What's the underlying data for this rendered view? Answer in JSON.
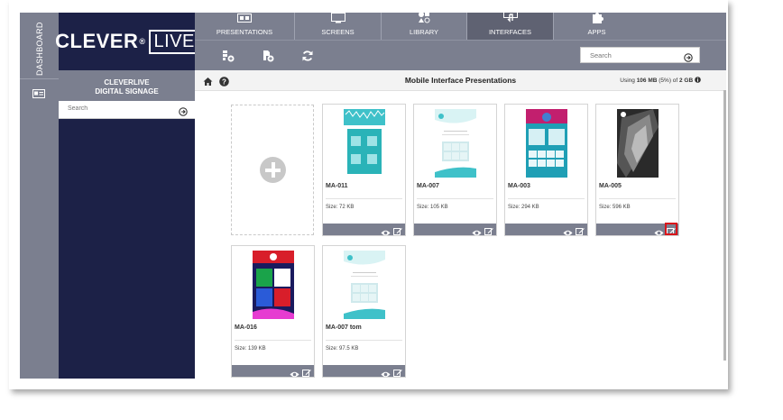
{
  "dashboard": {
    "label": "DASHBOARD"
  },
  "logo": {
    "brand": "CLEVER",
    "reg": "®",
    "live": "LIVE"
  },
  "sidebar": {
    "title_line1": "CLEVERLIVE",
    "title_line2": "DIGITAL SIGNAGE",
    "search_placeholder": "Search"
  },
  "tabs": [
    {
      "label": "PRESENTATIONS",
      "icon": "presentation-icon"
    },
    {
      "label": "SCREENS",
      "icon": "monitor-icon"
    },
    {
      "label": "LIBRARY",
      "icon": "media-library-icon"
    },
    {
      "label": "INTERFACES",
      "icon": "touch-interface-icon",
      "active": true
    },
    {
      "label": "APPS",
      "icon": "puzzle-icon"
    }
  ],
  "toolbar": {
    "search_placeholder": "Search",
    "buttons": [
      "add-interface-icon",
      "add-file-icon",
      "refresh-icon"
    ]
  },
  "content": {
    "title": "Mobile Interface Presentations",
    "usage_prefix": "Using ",
    "usage_used": "106 MB",
    "usage_mid": " (5%) of ",
    "usage_total": "2 GB"
  },
  "cards": [
    {
      "name": "MA-011",
      "size": "Size: 72 KB"
    },
    {
      "name": "MA-007",
      "size": "Size: 105 KB"
    },
    {
      "name": "MA-003",
      "size": "Size: 294 KB"
    },
    {
      "name": "MA-005",
      "size": "Size: 596 KB"
    },
    {
      "name": "MA-016",
      "size": "Size: 139 KB"
    },
    {
      "name": "MA-007 tom",
      "size": "Size: 97.5 KB"
    }
  ],
  "colors": {
    "navy": "#1c2147",
    "gray_bar": "#7b7f8f",
    "active_tab": "#5f6272",
    "highlight": "#d8141a"
  }
}
